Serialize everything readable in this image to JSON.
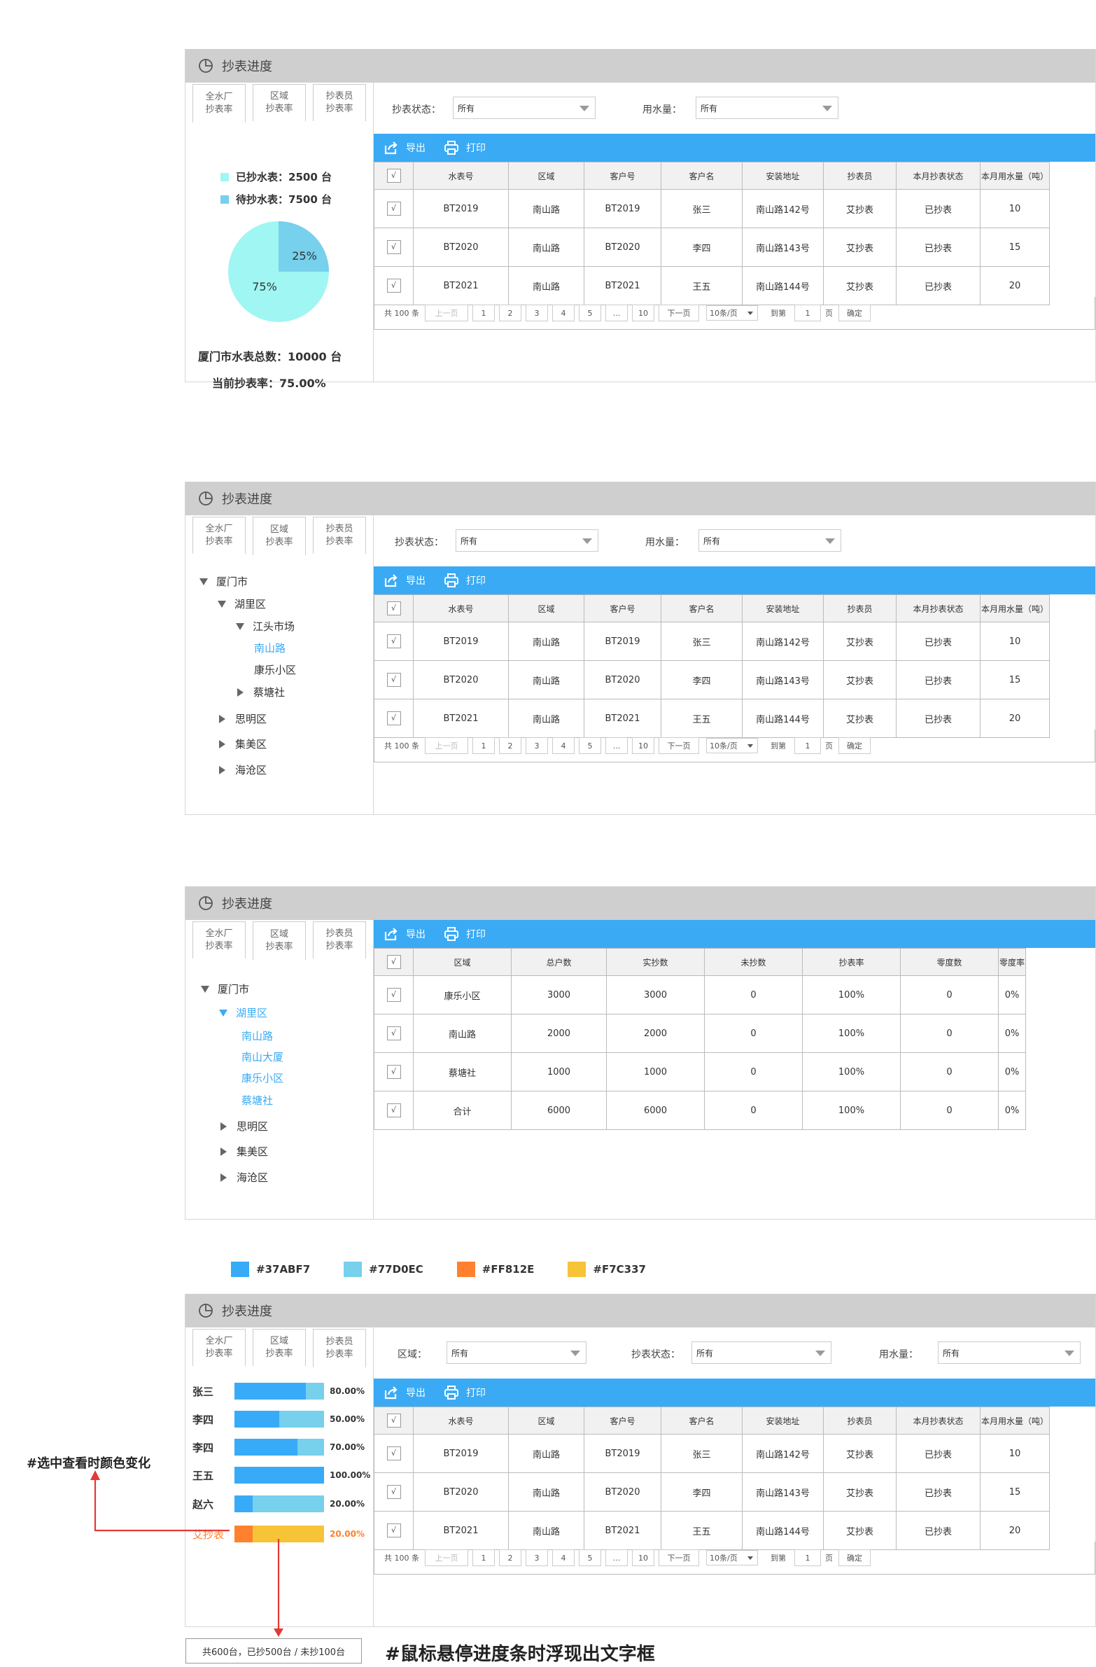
{
  "panel_title": "抄表进度",
  "tabs": [
    {
      "line1": "全水厂",
      "line2": "抄表率"
    },
    {
      "line1": "区域",
      "line2": "抄表率"
    },
    {
      "line1": "抄表员",
      "line2": "抄表率"
    }
  ],
  "filters": {
    "status_label": "抄表状态：",
    "water_label": "用水量：",
    "region_label": "区域：",
    "all": "所有"
  },
  "toolbar": {
    "export": "导出",
    "print": "打印"
  },
  "meter_table": {
    "headers": [
      "水表号",
      "区域",
      "客户号",
      "客户名",
      "安装地址",
      "抄表员",
      "本月抄表状态",
      "本月用水量（吨）"
    ],
    "rows": [
      {
        "meter": "BT2019",
        "area": "南山路",
        "cust_no": "BT2019",
        "cust_name": "张三",
        "addr": "南山路142号",
        "reader": "艾抄表",
        "status": "已抄表",
        "usage": "10"
      },
      {
        "meter": "BT2020",
        "area": "南山路",
        "cust_no": "BT2020",
        "cust_name": "李四",
        "addr": "南山路143号",
        "reader": "艾抄表",
        "status": "已抄表",
        "usage": "15"
      },
      {
        "meter": "BT2021",
        "area": "南山路",
        "cust_no": "BT2021",
        "cust_name": "王五",
        "addr": "南山路144号",
        "reader": "艾抄表",
        "status": "已抄表",
        "usage": "20"
      }
    ]
  },
  "pager": {
    "total": "共 100 条",
    "prev": "上一页",
    "pages": [
      "1",
      "2",
      "3",
      "4",
      "5",
      "...",
      "10"
    ],
    "next": "下一页",
    "per_page": "10条/页",
    "goto": "到第",
    "page_value": "1",
    "page_unit": "页",
    "confirm": "确定"
  },
  "summary": {
    "done_label": "已抄水表：",
    "done_value": "2500 台",
    "pending_label": "待抄水表：",
    "pending_value": "7500 台",
    "pie_done_pct": "25%",
    "pie_pending_pct": "75%",
    "pie_done_fraction": 0.25,
    "total_label": "厦门市水表总数：",
    "total_value": "10000 台",
    "rate_label": "当前抄表率：",
    "rate_value": "75.00%"
  },
  "tree1": {
    "xiamen": "厦门市",
    "huli": "湖里区",
    "jiangtou": "江头市场",
    "nanshan": "南山路",
    "kangle": "康乐小区",
    "caitang": "蔡塘社",
    "siming": "思明区",
    "jimei": "集美区",
    "haicang": "海沧区"
  },
  "tree2": {
    "xiamen": "厦门市",
    "huli": "湖里区",
    "nanshan": "南山路",
    "nanshan_dasha": "南山大厦",
    "kangle": "康乐小区",
    "caitang": "蔡塘社",
    "siming": "思明区",
    "jimei": "集美区",
    "haicang": "海沧区"
  },
  "region_table": {
    "headers": [
      "区域",
      "总户数",
      "实抄数",
      "未抄数",
      "抄表率",
      "零度数",
      "零度率"
    ],
    "rows": [
      {
        "area": "康乐小区",
        "total": "3000",
        "read": "3000",
        "unread": "0",
        "rate": "100%",
        "zero": "0",
        "zero_rate": "0%"
      },
      {
        "area": "南山路",
        "total": "2000",
        "read": "2000",
        "unread": "0",
        "rate": "100%",
        "zero": "0",
        "zero_rate": "0%"
      },
      {
        "area": "蔡塘社",
        "total": "1000",
        "read": "1000",
        "unread": "0",
        "rate": "100%",
        "zero": "0",
        "zero_rate": "0%"
      },
      {
        "area": "合计",
        "total": "6000",
        "read": "6000",
        "unread": "0",
        "rate": "100%",
        "zero": "0",
        "zero_rate": "0%"
      }
    ]
  },
  "colors": {
    "blue": "#37ABF7",
    "light_blue": "#77D0EC",
    "orange": "#FF812E",
    "yellow": "#F7C337"
  },
  "color_legend": [
    "#37ABF7",
    "#77D0EC",
    "#FF812E",
    "#F7C337"
  ],
  "readers": [
    {
      "name": "张三",
      "pct": "80.00%",
      "fraction": 0.8
    },
    {
      "name": "李四",
      "pct": "50.00%",
      "fraction": 0.5
    },
    {
      "name": "李四",
      "pct": "70.00%",
      "fraction": 0.7
    },
    {
      "name": "王五",
      "pct": "100.00%",
      "fraction": 1.0
    },
    {
      "name": "赵六",
      "pct": "20.00%",
      "fraction": 0.2
    },
    {
      "name": "艾抄表",
      "pct": "20.00%",
      "fraction": 0.2
    }
  ],
  "annotations": {
    "select_note": "#选中查看时颜色变化",
    "hover_note": "#鼠标悬停进度条时浮现出文字框",
    "tooltip": "共600台，已抄500台 / 未抄100台"
  }
}
